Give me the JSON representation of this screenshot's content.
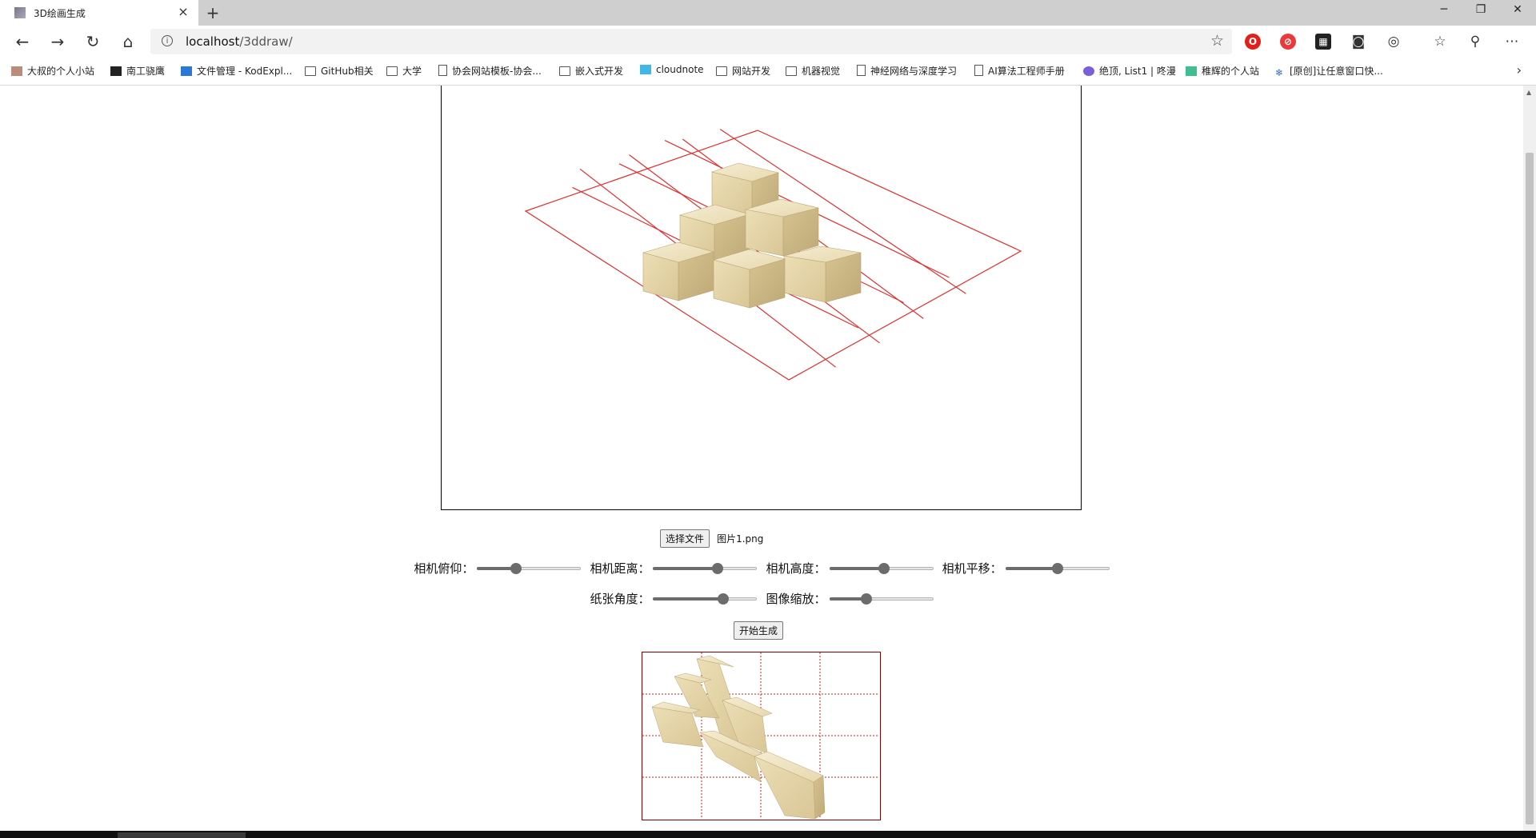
{
  "tab": {
    "title": "3D绘画生成"
  },
  "address_bar": {
    "host": "localhost",
    "path": "/3ddraw/"
  },
  "bookmarks": [
    "大叔的个人小站",
    "南工骁鹰",
    "文件管理 - KodExpl...",
    "GitHub相关",
    "大学",
    "协会网站模板-协会...",
    "嵌入式开发",
    "cloudnote",
    "网站开发",
    "机器视觉",
    "神经网络与深度学习",
    "AI算法工程师手册",
    "绝顶, List1 | 咚漫",
    "稚辉的个人站",
    "[原创]让任意窗口快..."
  ],
  "file_input": {
    "button_label": "选择文件",
    "file_name": "图片1.png"
  },
  "controls": {
    "pitch": {
      "label": "相机俯仰：",
      "value": 0.38
    },
    "distance": {
      "label": "相机距离：",
      "value": 0.62
    },
    "height": {
      "label": "相机高度：",
      "value": 0.52
    },
    "pan": {
      "label": "相机平移：",
      "value": 0.5
    },
    "paper_angle": {
      "label": "纸张角度：",
      "value": 0.68
    },
    "scale": {
      "label": "图像缩放：",
      "value": 0.35
    }
  },
  "start_button": "开始生成",
  "colors": {
    "grid_red": "#e03030",
    "wood_light": "#efe3bf",
    "wood_mid": "#d8c596",
    "wood_dark": "#c2ad78"
  }
}
